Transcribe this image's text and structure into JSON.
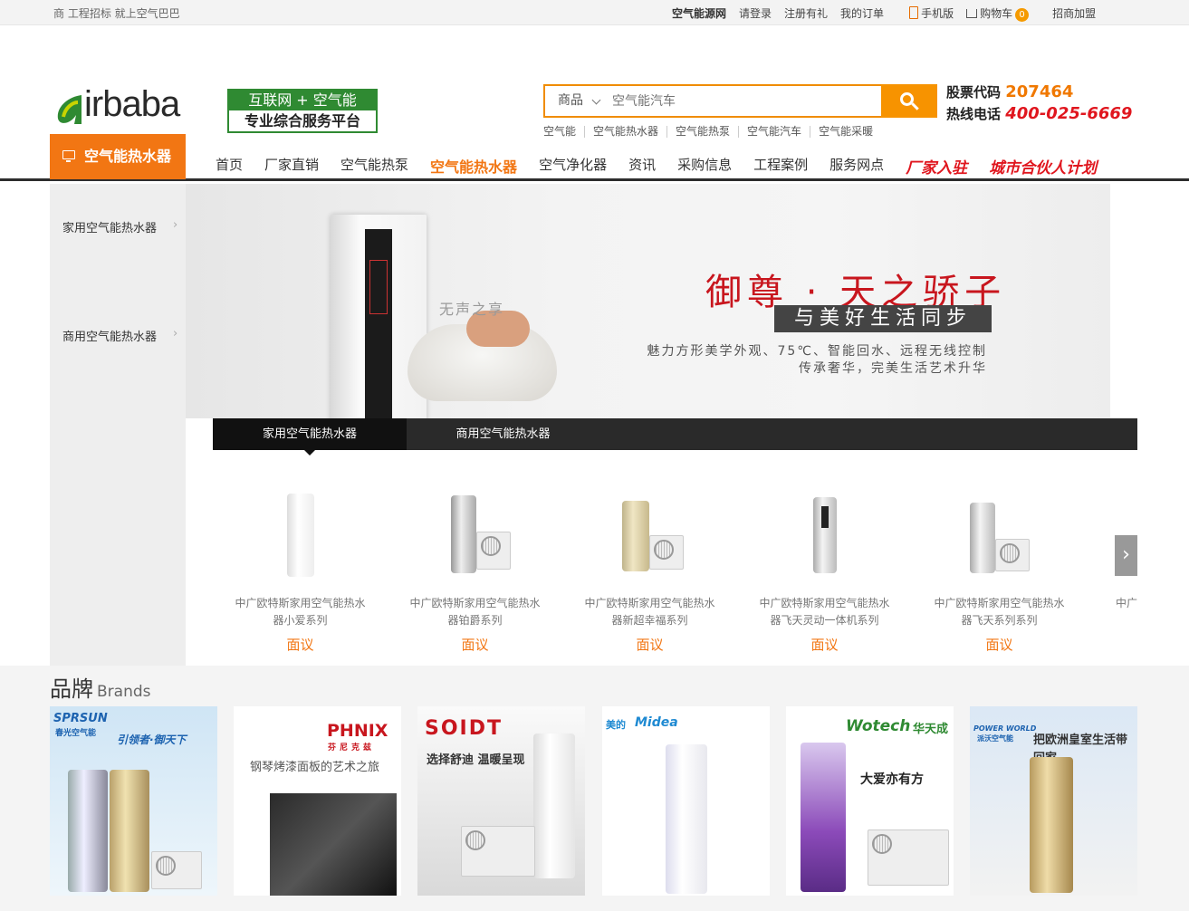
{
  "topbar": {
    "slogan": "商 工程招标 就上空气巴巴",
    "links": [
      "空气能源网",
      "请登录",
      "注册有礼",
      "我的订单"
    ],
    "mobile": "手机版",
    "cart": "购物车",
    "cart_count": "0",
    "join": "招商加盟"
  },
  "logo": {
    "text": "irbaba",
    "tag1": "互联网 + 空气能",
    "tag2": "专业综合服务平台"
  },
  "search": {
    "scope": "商品",
    "placeholder": "空气能汽车",
    "hotwords": [
      "空气能",
      "空气能热水器",
      "空气能热泵",
      "空气能汽车",
      "空气能采暖"
    ]
  },
  "contact": {
    "stock_label": "股票代码",
    "stock_value": "207464",
    "hotline_label": "热线电话",
    "hotline_value": "400-025-6669"
  },
  "nav": {
    "category": "空气能热水器",
    "items": [
      "首页",
      "厂家直销",
      "空气能热泵",
      "空气能热水器",
      "空气净化器",
      "资讯",
      "采购信息",
      "工程案例",
      "服务网点"
    ],
    "special": [
      "厂家入驻",
      "城市合伙人计划"
    ]
  },
  "sidebar": {
    "items": [
      "家用空气能热水器",
      "商用空气能热水器"
    ]
  },
  "banner": {
    "title": "御尊 · 天之骄子",
    "subtitle": "与美好生活同步",
    "line1": "魅力方形美学外观、75℃、智能回水、远程无线控制",
    "line2": "传承奢华，完美生活艺术升华",
    "whisper": "无声之享"
  },
  "tabs": [
    "家用空气能热水器",
    "商用空气能热水器"
  ],
  "products": [
    {
      "name": "中广欧特斯家用空气能热水器小爱系列",
      "price": "面议"
    },
    {
      "name": "中广欧特斯家用空气能热水器铂爵系列",
      "price": "面议"
    },
    {
      "name": "中广欧特斯家用空气能热水器新超幸福系列",
      "price": "面议"
    },
    {
      "name": "中广欧特斯家用空气能热水器飞天灵动一体机系列",
      "price": "面议"
    },
    {
      "name": "中广欧特斯家用空气能热水器飞天系列系列",
      "price": "面议"
    },
    {
      "name": "中广欧",
      "price": ""
    }
  ],
  "brands": {
    "title": "品牌",
    "subtitle": "Brands",
    "items": [
      {
        "name": "SPRSUN",
        "cn": "春光空气能",
        "slogan": "引领者·御天下"
      },
      {
        "name": "PHNIX",
        "cn": "芬尼克兹",
        "slogan": "钢琴烤漆面板的艺术之旅"
      },
      {
        "name": "SOIDT",
        "cn": "",
        "slogan": "选择舒迪 温暖呈现"
      },
      {
        "name": "Midea",
        "cn": "美的",
        "slogan": ""
      },
      {
        "name": "Wotech",
        "cn": "华天成",
        "slogan": "大爱亦有方"
      },
      {
        "name": "POWER WORLD",
        "cn": "派沃空气能",
        "slogan": "把欧洲皇室生活带回家"
      }
    ]
  }
}
